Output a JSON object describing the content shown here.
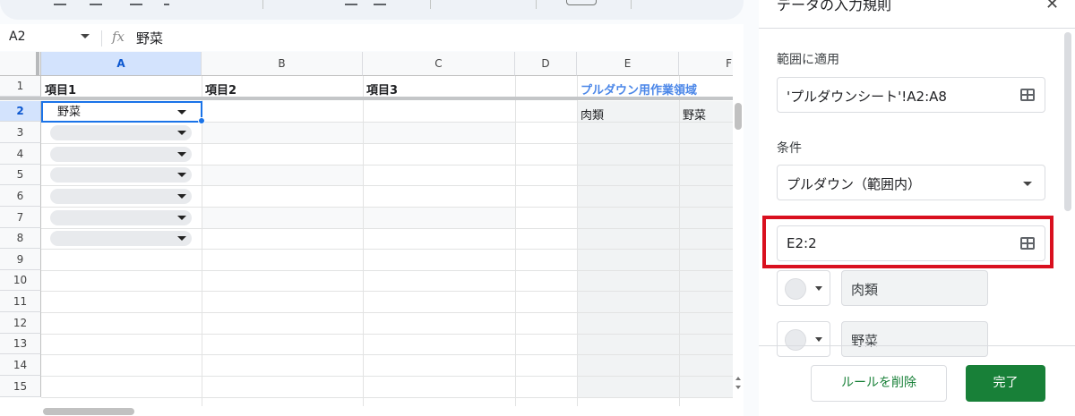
{
  "formula_bar": {
    "name_box": "A2",
    "fx_label": "fx",
    "value": "野菜"
  },
  "columns": [
    "A",
    "B",
    "C",
    "D",
    "E",
    "F"
  ],
  "rows": [
    "1",
    "2",
    "3",
    "4",
    "5",
    "6",
    "7",
    "8",
    "9",
    "10",
    "11",
    "12",
    "13",
    "14",
    "15"
  ],
  "cells": {
    "A1": "項目1",
    "B1": "項目2",
    "C1": "項目3",
    "E1": "プルダウン用作業領域",
    "A2": "野菜",
    "E2": "肉類",
    "F2": "野菜"
  },
  "panel": {
    "title": "データの入力規則",
    "range_label": "範囲に適用",
    "range_value": "'プルダウンシート'!A2:A8",
    "criteria_label": "条件",
    "criteria_value": "プルダウン（範囲内）",
    "source_range": "E2:2",
    "items": [
      "肉類",
      "野菜"
    ],
    "delete_button": "ルールを削除",
    "done_button": "完了"
  },
  "colors": {
    "accent": "#188038",
    "selection": "#1a73e8",
    "highlight": "#d9101f",
    "header_blue": "#4a86e8"
  }
}
